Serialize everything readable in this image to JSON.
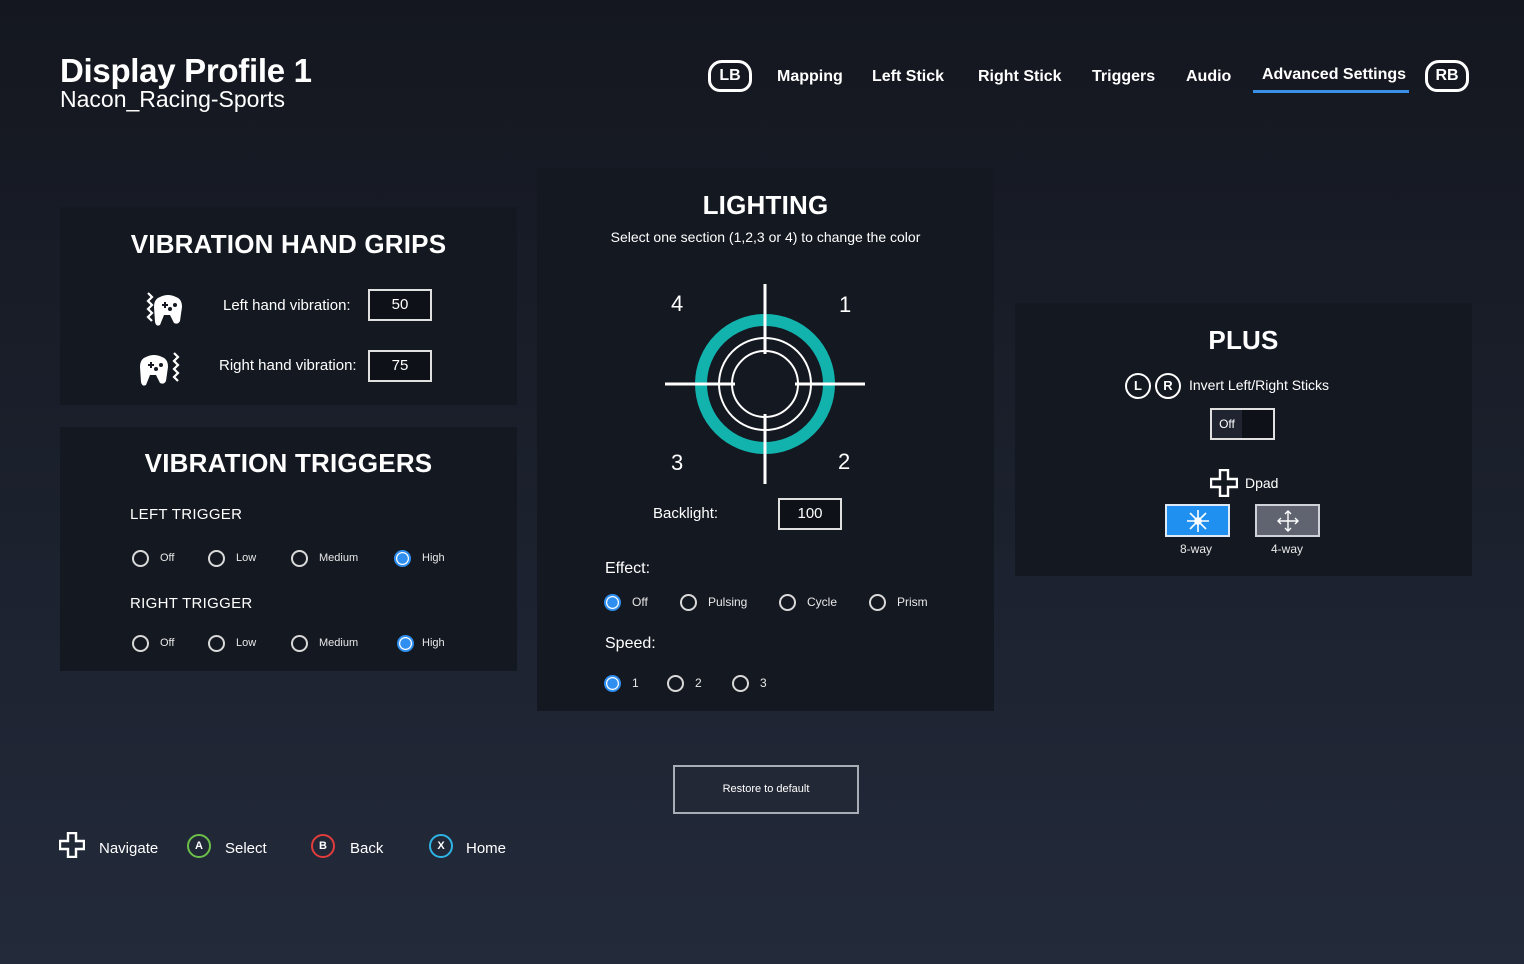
{
  "header": {
    "title": "Display Profile 1",
    "subtitle": "Nacon_Racing-Sports"
  },
  "nav": {
    "left_bumper": "LB",
    "right_bumper": "RB",
    "tabs": [
      "Mapping",
      "Left Stick",
      "Right Stick",
      "Triggers",
      "Audio",
      "Advanced Settings"
    ],
    "active_tab": "Advanced Settings"
  },
  "vibration_hand_grips": {
    "title": "VIBRATION HAND GRIPS",
    "left_label": "Left hand vibration:",
    "left_value": "50",
    "right_label": "Right hand vibration:",
    "right_value": "75"
  },
  "vibration_triggers": {
    "title": "VIBRATION TRIGGERS",
    "left_trigger_label": "LEFT TRIGGER",
    "right_trigger_label": "RIGHT TRIGGER",
    "options": [
      "Off",
      "Low",
      "Medium",
      "High"
    ],
    "left_selected": "High",
    "right_selected": "High"
  },
  "lighting": {
    "title": "LIGHTING",
    "subtitle": "Select one section (1,2,3 or 4) to change the color",
    "sections": [
      "1",
      "2",
      "3",
      "4"
    ],
    "ring_color": "#12b3ad",
    "backlight_label": "Backlight:",
    "backlight_value": "100",
    "effect_label": "Effect:",
    "effect_options": [
      "Off",
      "Pulsing",
      "Cycle",
      "Prism"
    ],
    "effect_selected": "Off",
    "speed_label": "Speed:",
    "speed_options": [
      "1",
      "2",
      "3"
    ],
    "speed_selected": "1"
  },
  "plus": {
    "title": "PLUS",
    "invert_l": "L",
    "invert_r": "R",
    "invert_label": "Invert Left/Right Sticks",
    "invert_value": "Off",
    "dpad_label": "Dpad",
    "dpad_options": [
      "8-way",
      "4-way"
    ],
    "dpad_selected": "8-way"
  },
  "restore_button": "Restore to default",
  "hints": {
    "navigate": "Navigate",
    "select": "Select",
    "select_key": "A",
    "back": "Back",
    "back_key": "B",
    "home": "Home",
    "home_key": "X"
  },
  "colors": {
    "accent": "#2e8ff0",
    "panel": "#141821",
    "a_button": "#6cc04a",
    "b_button": "#e23c3c",
    "x_button": "#2fb4e6"
  }
}
